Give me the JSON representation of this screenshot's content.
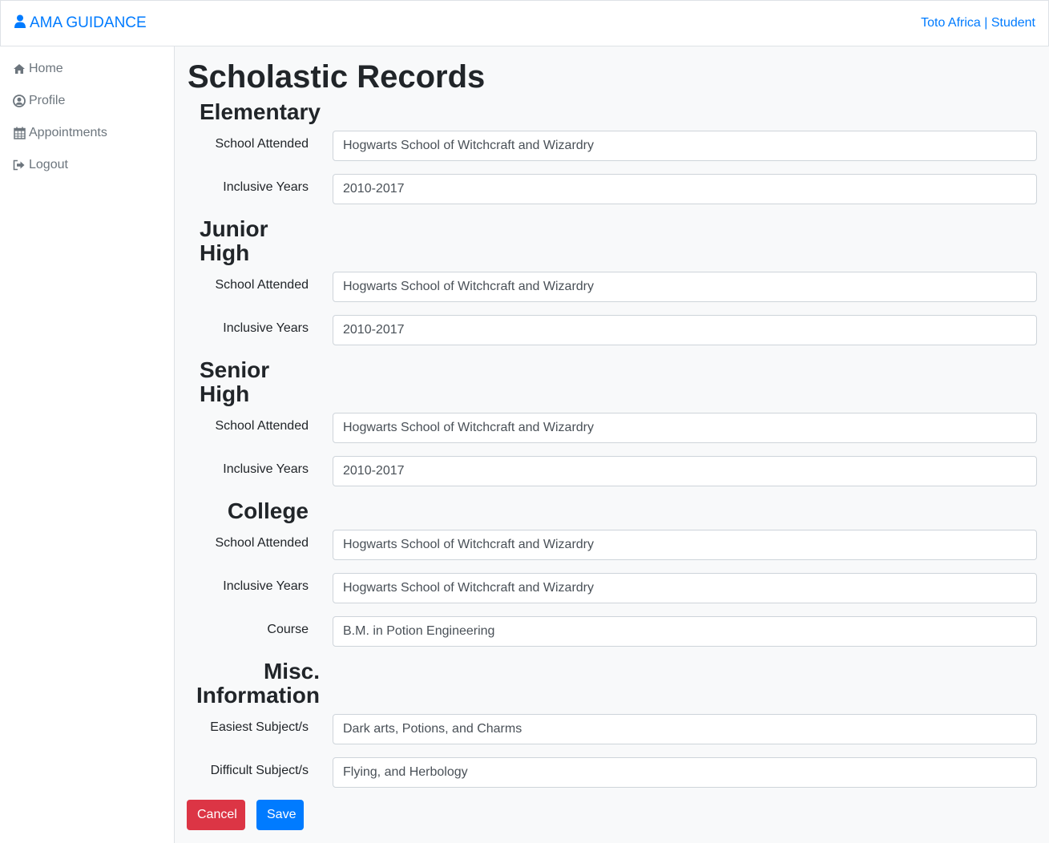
{
  "navbar": {
    "brand": "AMA GUIDANCE",
    "user": "Toto Africa | Student",
    "brand_icon": "user-icon"
  },
  "sidebar": {
    "items": [
      {
        "label": "Home",
        "icon": "home-icon"
      },
      {
        "label": "Profile",
        "icon": "user-circle-icon"
      },
      {
        "label": "Appointments",
        "icon": "calendar-icon"
      },
      {
        "label": "Logout",
        "icon": "sign-out-icon"
      }
    ]
  },
  "page": {
    "title": "Scholastic Records"
  },
  "elementary": {
    "heading": "Elementary",
    "school_label": "School Attended",
    "school_value": "Hogwarts School of Witchcraft and Wizardry",
    "years_label": "Inclusive Years",
    "years_value": "2010-2017"
  },
  "junior_high": {
    "heading_line1": "Junior",
    "heading_line2": "High",
    "school_label": "School Attended",
    "school_value": "Hogwarts School of Witchcraft and Wizardry",
    "years_label": "Inclusive Years",
    "years_value": "2010-2017"
  },
  "senior_high": {
    "heading_line1": "Senior",
    "heading_line2": "High",
    "school_label": "School Attended",
    "school_value": "Hogwarts School of Witchcraft and Wizardry",
    "years_label": "Inclusive Years",
    "years_value": "2010-2017"
  },
  "college": {
    "heading": "College",
    "school_label": "School Attended",
    "school_value": "Hogwarts School of Witchcraft and Wizardry",
    "years_label": "Inclusive Years",
    "years_value": "Hogwarts School of Witchcraft and Wizardry",
    "course_label": "Course",
    "course_value": "B.M. in Potion Engineering"
  },
  "misc": {
    "heading_line1": "Misc.",
    "heading_line2": "Information",
    "easiest_label": "Easiest Subject/s",
    "easiest_value": "Dark arts, Potions, and Charms",
    "difficult_label": "Difficult Subject/s",
    "difficult_value": "Flying, and Herbology"
  },
  "buttons": {
    "cancel": "Cancel",
    "save": "Save"
  },
  "colors": {
    "primary": "#007bff",
    "danger": "#dc3545",
    "background": "#f8f9fa"
  }
}
